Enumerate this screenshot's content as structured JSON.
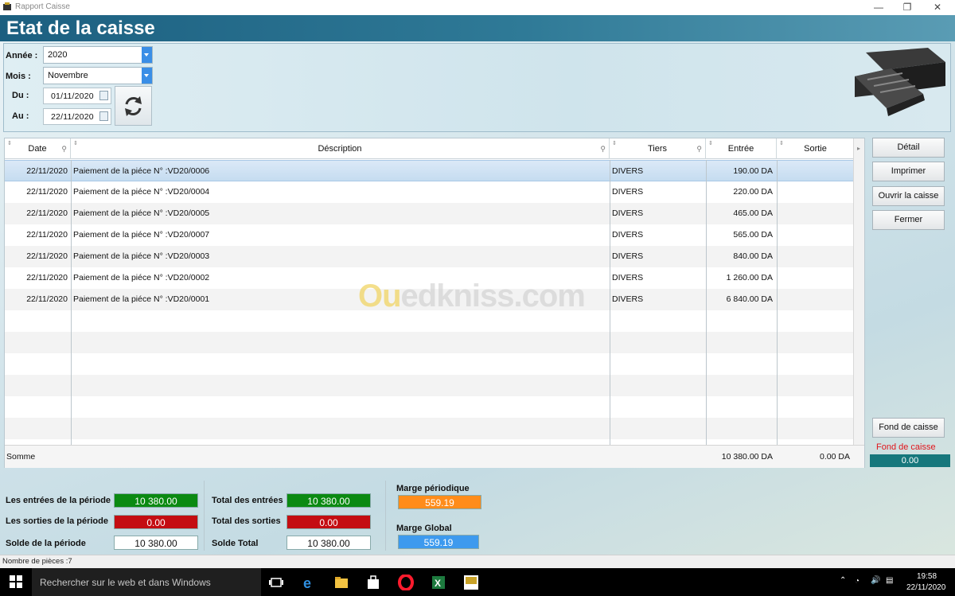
{
  "window": {
    "title": "Rapport Caisse",
    "header": "Etat de la caisse",
    "controls": [
      "—",
      "❐",
      "✕"
    ]
  },
  "filters": {
    "annee_label": "Année :",
    "annee_value": "2020",
    "mois_label": "Mois :",
    "mois_value": "Novembre",
    "du_label": "Du :",
    "du_value": "01/11/2020",
    "au_label": "Au :",
    "au_value": "22/11/2020"
  },
  "table": {
    "columns": [
      "Date",
      "Déscription",
      "Tiers",
      "Entrée",
      "Sortie"
    ],
    "rows": [
      {
        "date": "22/11/2020",
        "desc": "Paiement de la piéce N° :VD20/0006",
        "tiers": "DIVERS",
        "entree": "190.00 DA",
        "sortie": ""
      },
      {
        "date": "22/11/2020",
        "desc": "Paiement de la piéce N° :VD20/0004",
        "tiers": "DIVERS",
        "entree": "220.00 DA",
        "sortie": ""
      },
      {
        "date": "22/11/2020",
        "desc": "Paiement de la piéce N° :VD20/0005",
        "tiers": "DIVERS",
        "entree": "465.00 DA",
        "sortie": ""
      },
      {
        "date": "22/11/2020",
        "desc": "Paiement de la piéce N° :VD20/0007",
        "tiers": "DIVERS",
        "entree": "565.00 DA",
        "sortie": ""
      },
      {
        "date": "22/11/2020",
        "desc": "Paiement de la piéce N° :VD20/0003",
        "tiers": "DIVERS",
        "entree": "840.00 DA",
        "sortie": ""
      },
      {
        "date": "22/11/2020",
        "desc": "Paiement de la piéce N° :VD20/0002",
        "tiers": "DIVERS",
        "entree": "1 260.00 DA",
        "sortie": ""
      },
      {
        "date": "22/11/2020",
        "desc": "Paiement de la piéce N° :VD20/0001",
        "tiers": "DIVERS",
        "entree": "6 840.00 DA",
        "sortie": ""
      }
    ],
    "footer": {
      "label": "Somme",
      "entree": "10 380.00 DA",
      "sortie": "0.00 DA"
    }
  },
  "buttons": {
    "detail": "Détail",
    "imprimer": "Imprimer",
    "ouvrir": "Ouvrir la caisse",
    "fermer": "Fermer",
    "fond": "Fond de caisse"
  },
  "fond": {
    "label": "Fond de caisse",
    "value": "0.00"
  },
  "totals": {
    "entrees_periode_label": "Les entrées de la période",
    "entrees_periode": "10 380.00",
    "sorties_periode_label": "Les sorties de la période",
    "sorties_periode": "0.00",
    "solde_periode_label": "Solde de la période",
    "solde_periode": "10 380.00",
    "total_entrees_label": "Total des entrées",
    "total_entrees": "10 380.00",
    "total_sorties_label": "Total des sorties",
    "total_sorties": "0.00",
    "solde_total_label": "Solde Total",
    "solde_total": "10 380.00",
    "marge_periodique_label": "Marge périodique",
    "marge_periodique": "559.19",
    "marge_global_label": "Marge Global",
    "marge_global": "559.19"
  },
  "status": {
    "text": "Nombre de pièces :7"
  },
  "watermark": {
    "text_a": "Ou",
    "text_b": "edkniss.com"
  },
  "taskbar": {
    "search_placeholder": "Rechercher sur le web et dans Windows",
    "time": "19:58",
    "date": "22/11/2020"
  },
  "colors": {
    "header": "#1c5f80",
    "green": "#0b8a12",
    "red": "#c40d12",
    "orange": "#ff8c1a",
    "blue": "#3d9aee",
    "teal": "#16777c"
  }
}
